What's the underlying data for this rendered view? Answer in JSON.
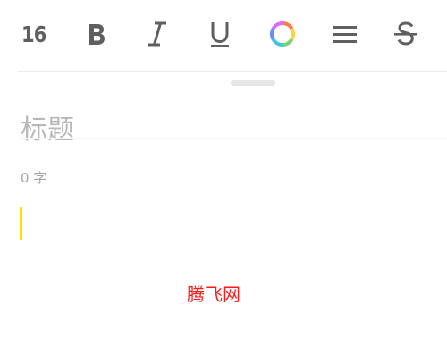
{
  "toolbar": {
    "font_size": "16",
    "tools": [
      {
        "name": "bold",
        "icon": "bold-icon"
      },
      {
        "name": "italic",
        "icon": "italic-icon"
      },
      {
        "name": "underline",
        "icon": "underline-icon"
      },
      {
        "name": "text-color",
        "icon": "color-wheel-icon"
      },
      {
        "name": "align",
        "icon": "align-lines-icon"
      },
      {
        "name": "strikethrough",
        "icon": "strikethrough-icon"
      }
    ],
    "icon_color": "#5f5f5f"
  },
  "editor": {
    "title_placeholder": "标题",
    "word_count": "0 字",
    "cursor_color": "#ffe100"
  },
  "watermark": {
    "text": "腾飞网",
    "color": "#ff1a1a"
  }
}
